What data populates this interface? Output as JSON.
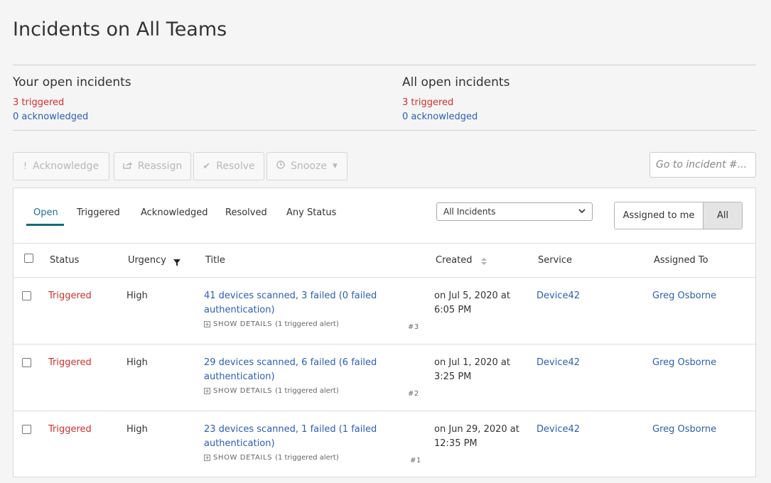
{
  "page_title": "Incidents on All Teams",
  "summary": {
    "yours": {
      "heading": "Your open incidents",
      "triggered": "3 triggered",
      "acknowledged": "0 acknowledged"
    },
    "all": {
      "heading": "All open incidents",
      "triggered": "3 triggered",
      "acknowledged": "0 acknowledged"
    }
  },
  "toolbar": {
    "acknowledge": "Acknowledge",
    "reassign": "Reassign",
    "resolve": "Resolve",
    "snooze": "Snooze",
    "goto_placeholder": "Go to incident #..."
  },
  "tabs": [
    "Open",
    "Triggered",
    "Acknowledged",
    "Resolved",
    "Any Status"
  ],
  "filter_select": "All Incidents",
  "assign_toggle": {
    "assigned_to_me": "Assigned to me",
    "all": "All",
    "selected": "All"
  },
  "columns": [
    "Status",
    "Urgency",
    "Title",
    "Created",
    "Service",
    "Assigned To"
  ],
  "show_details_label": "SHOW DETAILS",
  "incidents": [
    {
      "status": "Triggered",
      "urgency": "High",
      "title": "41 devices scanned, 3 failed (0 failed authentication)",
      "alerts": "(1 triggered alert)",
      "number": "#3",
      "created": "on Jul 5, 2020 at 6:05 PM",
      "service": "Device42",
      "assigned_to": "Greg Osborne"
    },
    {
      "status": "Triggered",
      "urgency": "High",
      "title": "29 devices scanned, 6 failed (6 failed authentication)",
      "alerts": "(1 triggered alert)",
      "number": "#2",
      "created": "on Jul 1, 2020 at 3:25 PM",
      "service": "Device42",
      "assigned_to": "Greg Osborne"
    },
    {
      "status": "Triggered",
      "urgency": "High",
      "title": "23 devices scanned, 1 failed (1 failed authentication)",
      "alerts": "(1 triggered alert)",
      "number": "#1",
      "created": "on Jun 29, 2020 at 12:35 PM",
      "service": "Device42",
      "assigned_to": "Greg Osborne"
    }
  ],
  "colors": {
    "triggered": "#d0312d",
    "link": "#2b5fb3",
    "active_tab": "#136b7a"
  }
}
